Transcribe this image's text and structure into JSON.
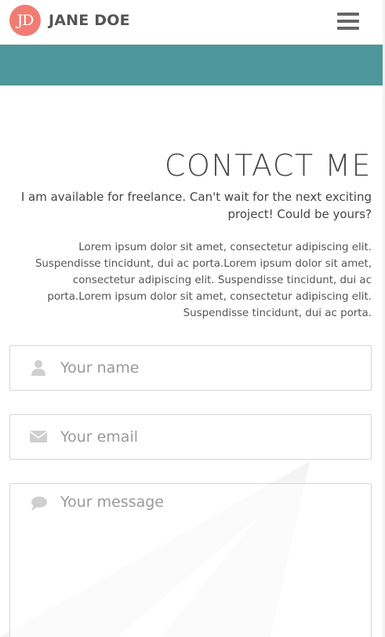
{
  "navbar": {
    "logo_text": "JD",
    "brand_name": "JANE DOE",
    "menu_icon": "hamburger-menu-icon"
  },
  "colors": {
    "accent_teal": "#4e979a",
    "logo_coral": "#f07d74"
  },
  "contact": {
    "heading": "CONTACT ME",
    "lead": "I am available for freelance. Can't wait for the next exciting project! Could be yours?",
    "body": "Lorem ipsum dolor sit amet, consectetur adipiscing elit. Suspendisse tincidunt, dui ac porta.Lorem ipsum dolor sit amet, consectetur adipiscing elit. Suspendisse tincidunt, dui ac porta.Lorem ipsum dolor sit amet, consectetur adipiscing elit. Suspendisse tincidunt, dui ac porta."
  },
  "form": {
    "name": {
      "placeholder": "Your name",
      "icon": "user-icon"
    },
    "email": {
      "placeholder": "Your email",
      "icon": "envelope-icon"
    },
    "message": {
      "placeholder": "Your message",
      "icon": "speech-bubble-icon"
    }
  },
  "decor": {
    "watermark_icon": "paper-plane-icon"
  }
}
